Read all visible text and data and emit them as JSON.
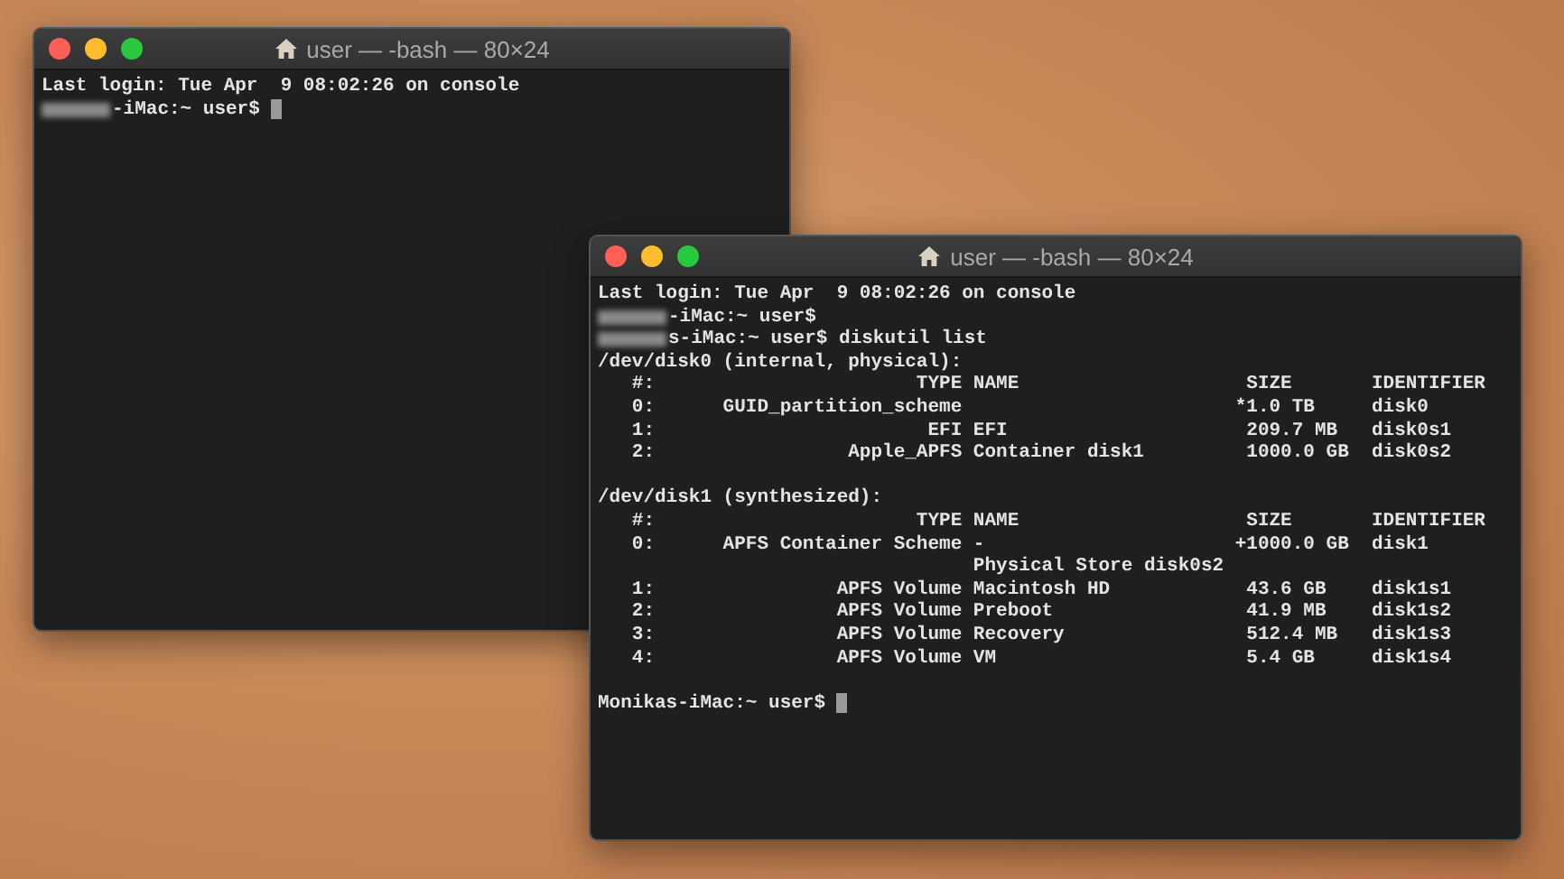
{
  "windows": [
    {
      "title": "user — -bash — 80×24",
      "lines": [
        {
          "kind": "text",
          "text": "Last login: Tue Apr  9 08:02:26 on console"
        },
        {
          "kind": "redacted",
          "text": "-iMac:~ user$ ",
          "cursor": true
        }
      ]
    },
    {
      "title": "user — -bash — 80×24",
      "lines": [
        {
          "kind": "text",
          "text": "Last login: Tue Apr  9 08:02:26 on console"
        },
        {
          "kind": "redacted",
          "text": "-iMac:~ user$",
          "cursor": false
        },
        {
          "kind": "redacted",
          "text": "s-iMac:~ user$ diskutil list",
          "cursor": false
        },
        {
          "kind": "text",
          "text": "/dev/disk0 (internal, physical):"
        },
        {
          "kind": "text",
          "text": "   #:                       TYPE NAME                    SIZE       IDENTIFIER"
        },
        {
          "kind": "text",
          "text": "   0:      GUID_partition_scheme                        *1.0 TB     disk0"
        },
        {
          "kind": "text",
          "text": "   1:                        EFI EFI                     209.7 MB   disk0s1"
        },
        {
          "kind": "text",
          "text": "   2:                 Apple_APFS Container disk1         1000.0 GB  disk0s2"
        },
        {
          "kind": "blank"
        },
        {
          "kind": "text",
          "text": "/dev/disk1 (synthesized):"
        },
        {
          "kind": "text",
          "text": "   #:                       TYPE NAME                    SIZE       IDENTIFIER"
        },
        {
          "kind": "text",
          "text": "   0:      APFS Container Scheme -                      +1000.0 GB  disk1"
        },
        {
          "kind": "text",
          "text": "                                 Physical Store disk0s2"
        },
        {
          "kind": "text",
          "text": "   1:                APFS Volume Macintosh HD            43.6 GB    disk1s1"
        },
        {
          "kind": "text",
          "text": "   2:                APFS Volume Preboot                 41.9 MB    disk1s2"
        },
        {
          "kind": "text",
          "text": "   3:                APFS Volume Recovery                512.4 MB   disk1s3"
        },
        {
          "kind": "text",
          "text": "   4:                APFS Volume VM                      5.4 GB     disk1s4"
        },
        {
          "kind": "blank"
        },
        {
          "kind": "prompt",
          "text": "Monikas-iMac:~ user$ ",
          "cursor": true
        }
      ]
    }
  ]
}
